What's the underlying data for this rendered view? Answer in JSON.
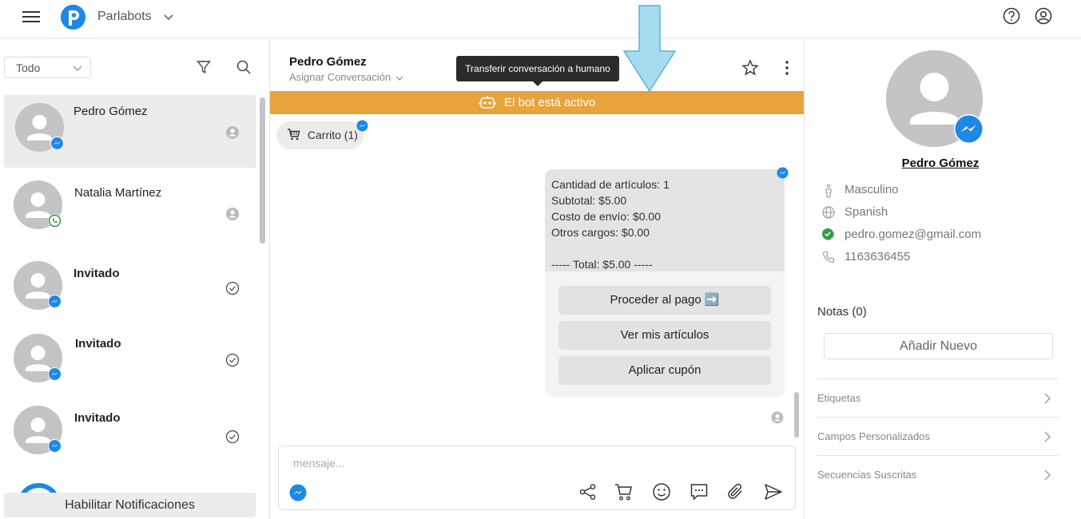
{
  "topbar": {
    "brand": "Parlabots"
  },
  "sidebar": {
    "filter_value": "Todo",
    "conversations": [
      {
        "name": "Pedro Gómez",
        "channel": "messenger",
        "bold": false
      },
      {
        "name": "Natalia Martínez",
        "channel": "whatsapp",
        "bold": false
      },
      {
        "name": "Invitado",
        "channel": "messenger",
        "bold": true
      },
      {
        "name": "Invitado",
        "channel": "messenger",
        "bold": true
      },
      {
        "name": "Invitado",
        "channel": "messenger",
        "bold": true
      }
    ],
    "notifications_button": "Habilitar Notificaciones"
  },
  "chat": {
    "contact_name": "Pedro Gómez",
    "assign_label": "Asignar Conversación",
    "tooltip": "Transferir conversación a humano",
    "bot_banner": "El bot está activo",
    "cart_chip": "Carrito (1)",
    "message_lines": [
      "Cantidad de artículos: 1",
      "Subtotal: $5.00",
      "Costo de envío: $0.00",
      "Otros cargos: $0.00",
      "",
      "----- Total: $5.00 -----"
    ],
    "buttons": [
      "Proceder al pago ➡️",
      "Ver mis artículos",
      "Aplicar cupón"
    ],
    "composer_placeholder": "mensaje..."
  },
  "profile": {
    "name": "Pedro Gómez",
    "gender": "Masculino",
    "language": "Spanish",
    "email": "pedro.gomez@gmail.com",
    "phone": "1163636455",
    "notes_title": "Notas (0)",
    "add_note": "Añadir Nuevo",
    "sections": [
      "Etiquetas",
      "Campos Personalizados",
      "Secuencias Suscritas"
    ]
  },
  "colors": {
    "bot_banner": "#e8a33c",
    "messenger": "#1e88e5",
    "whatsapp": "#25d366",
    "verified": "#2e9e44"
  }
}
